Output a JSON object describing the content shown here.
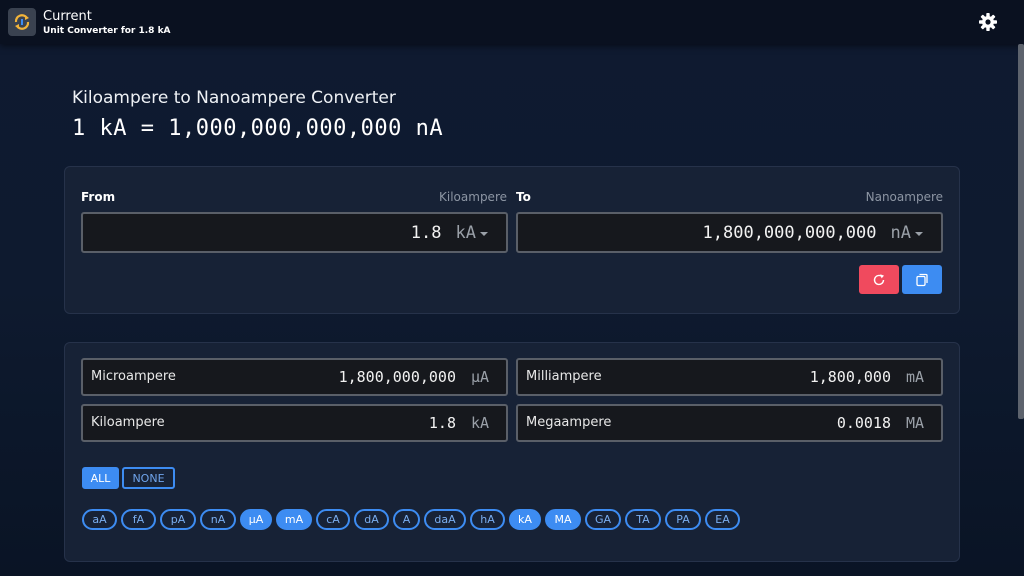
{
  "header": {
    "title": "Current",
    "subtitle": "Unit Converter for 1.8 kA",
    "app_icon": "sync-clock-icon",
    "settings_icon": "gear-icon"
  },
  "main": {
    "heading": "Kiloampere to Nanoampere Converter",
    "formula": "1 kA = 1,000,000,000,000 nA"
  },
  "converter": {
    "from_label": "From",
    "from_unit_name": "Kiloampere",
    "from_value": "1.8",
    "from_unit": "kA",
    "to_label": "To",
    "to_unit_name": "Nanoampere",
    "to_value": "1,800,000,000,000",
    "to_unit": "nA",
    "reset_icon": "refresh-icon",
    "copy_icon": "copy-icon"
  },
  "results": [
    {
      "name": "Microampere",
      "value": "1,800,000,000",
      "unit": "µA"
    },
    {
      "name": "Milliampere",
      "value": "1,800,000",
      "unit": "mA"
    },
    {
      "name": "Kiloampere",
      "value": "1.8",
      "unit": "kA"
    },
    {
      "name": "Megaampere",
      "value": "0.0018",
      "unit": "MA"
    }
  ],
  "filters": {
    "all_label": "ALL",
    "none_label": "NONE",
    "chips": [
      {
        "label": "aA",
        "selected": false
      },
      {
        "label": "fA",
        "selected": false
      },
      {
        "label": "pA",
        "selected": false
      },
      {
        "label": "nA",
        "selected": false
      },
      {
        "label": "µA",
        "selected": true
      },
      {
        "label": "mA",
        "selected": true
      },
      {
        "label": "cA",
        "selected": false
      },
      {
        "label": "dA",
        "selected": false
      },
      {
        "label": "A",
        "selected": false
      },
      {
        "label": "daA",
        "selected": false
      },
      {
        "label": "hA",
        "selected": false
      },
      {
        "label": "kA",
        "selected": true
      },
      {
        "label": "MA",
        "selected": true
      },
      {
        "label": "GA",
        "selected": false
      },
      {
        "label": "TA",
        "selected": false
      },
      {
        "label": "PA",
        "selected": false
      },
      {
        "label": "EA",
        "selected": false
      }
    ]
  },
  "colors": {
    "accent": "#3d8cf2",
    "danger": "#f04a5e",
    "background": "#0e1a2f",
    "card": "#172236"
  }
}
